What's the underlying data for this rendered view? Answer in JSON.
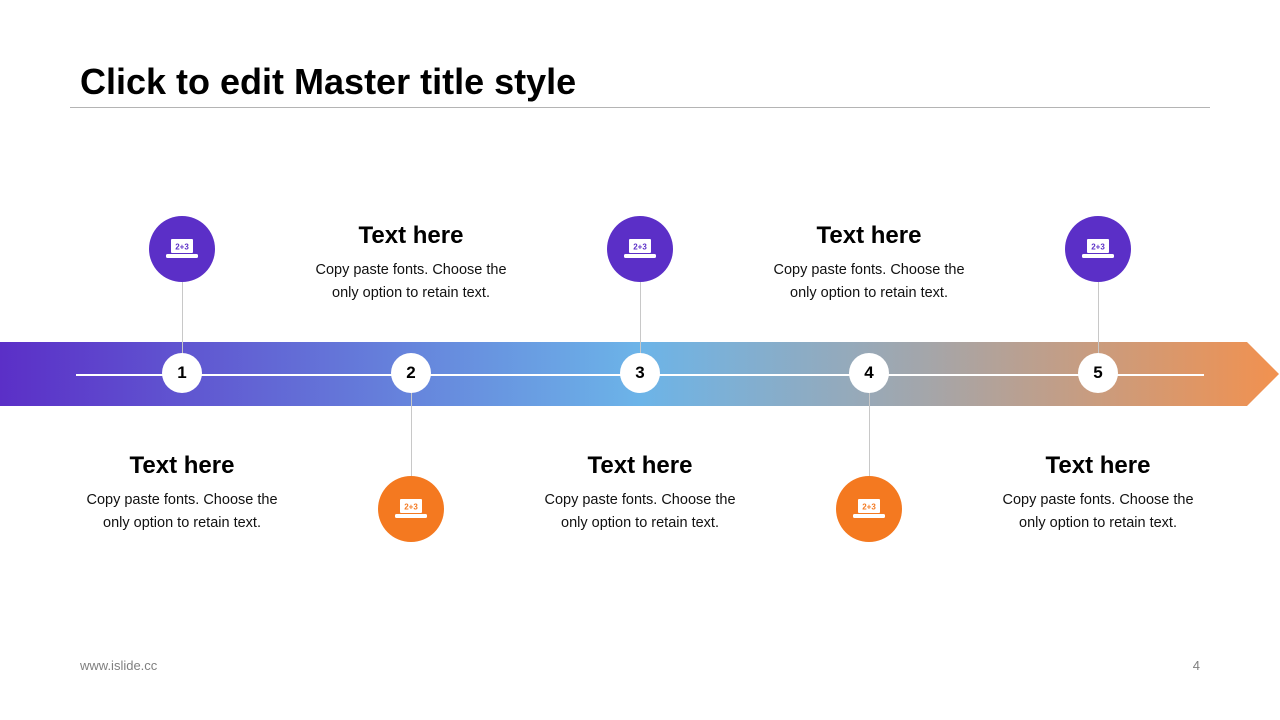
{
  "slide": {
    "title": "Click to edit Master title style"
  },
  "colors": {
    "purple": "#5b2fc7",
    "blue": "#6cb4e8",
    "gray": "#a3a6ab",
    "orange": "#f2914f",
    "icon_orange": "#f47920"
  },
  "icon": "laptop-math-icon",
  "icon_label": "2+3",
  "steps": [
    {
      "number": "1",
      "title": "Text here",
      "body_line1": "Copy paste fonts. Choose the",
      "body_line2": "only option to retain text."
    },
    {
      "number": "2",
      "title": "Text here",
      "body_line1": "Copy paste fonts. Choose the",
      "body_line2": "only option to retain text."
    },
    {
      "number": "3",
      "title": "Text here",
      "body_line1": "Copy paste fonts. Choose the",
      "body_line2": "only option to retain text."
    },
    {
      "number": "4",
      "title": "Text here",
      "body_line1": "Copy paste fonts. Choose the",
      "body_line2": "only option to retain text."
    },
    {
      "number": "5",
      "title": "Text here",
      "body_line1": "Copy paste fonts. Choose the",
      "body_line2": "only option to retain text."
    }
  ],
  "footer": {
    "url": "www.islide.cc",
    "page": "4"
  }
}
